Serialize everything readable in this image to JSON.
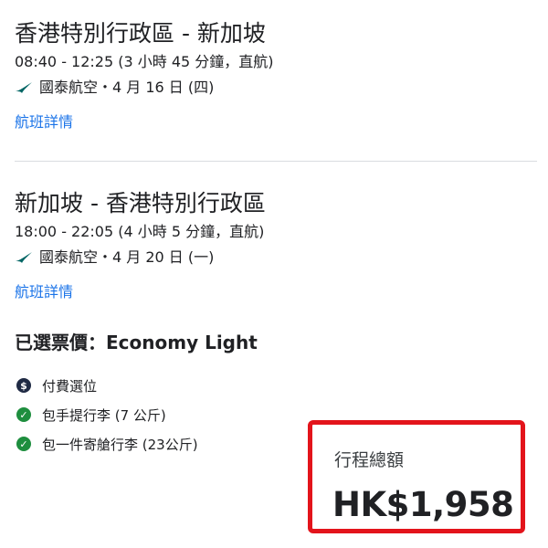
{
  "outbound": {
    "title": "香港特別行政區 - 新加坡",
    "times": "08:40 - 12:25 (3 小時 45 分鐘，直航)",
    "airline_line": "國泰航空・4 月 16 日 (四)",
    "details_link": "航班詳情"
  },
  "inbound": {
    "title": "新加坡 - 香港特別行政區",
    "times": "18:00 - 22:05 (4 小時 5 分鐘，直航)",
    "airline_line": "國泰航空・4 月 20 日 (一)",
    "details_link": "航班詳情"
  },
  "fare": {
    "title": "已選票價：Economy Light",
    "features": [
      {
        "icon": "dollar-icon",
        "text": "付費選位"
      },
      {
        "icon": "check-icon",
        "text": "包手提行李 (7 公斤)"
      },
      {
        "icon": "check-icon",
        "text": "包一件寄艙行李 (23公斤)"
      }
    ]
  },
  "total": {
    "label": "行程總額",
    "price": "HK$1,958"
  },
  "colors": {
    "link": "#1a73e8",
    "highlight_border": "#e3141b",
    "check": "#1e8e3e",
    "airline_logo": "#006564"
  }
}
